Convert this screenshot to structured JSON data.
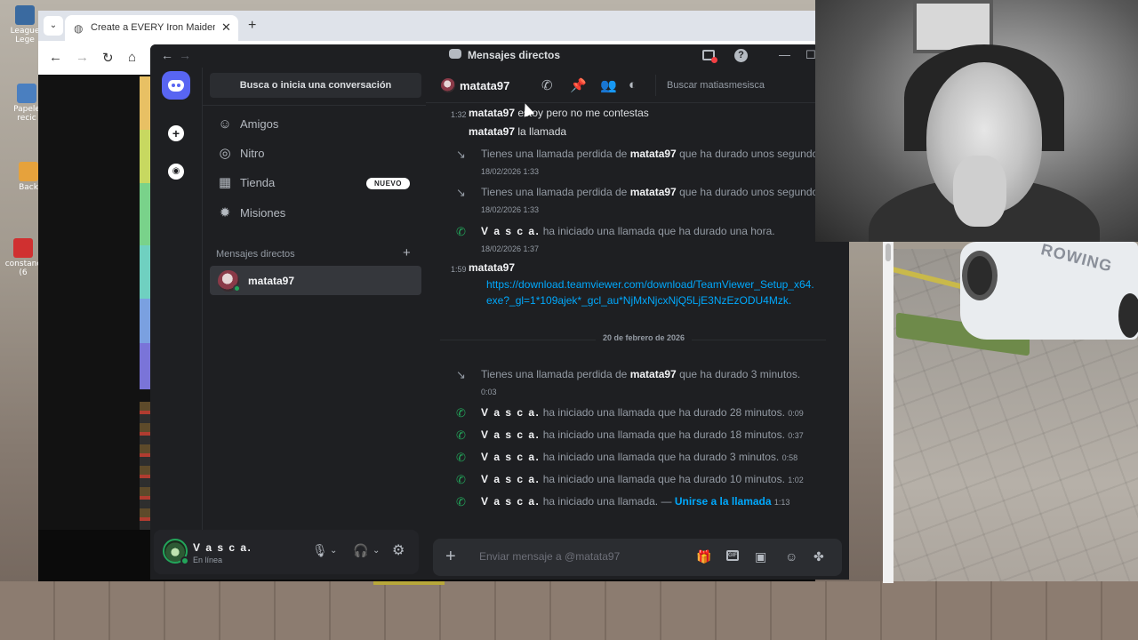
{
  "browser": {
    "tab_title": "Create a EVERY Iron Maiden Sc",
    "tab_close": "✕",
    "new_tab": "+"
  },
  "desktop": {
    "icons": [
      {
        "label": "League Lege",
        "color": "#3a6aa0"
      },
      {
        "label": "Papele recic",
        "color": "#4a7fc0"
      },
      {
        "label": "Back",
        "color": "#e6a23c"
      },
      {
        "label": "constanc (6",
        "color": "#d03030"
      }
    ]
  },
  "discord": {
    "window_title": "Mensajes directos",
    "search_placeholder": "Busca o inicia una conversación",
    "nav": [
      {
        "label": "Amigos",
        "icon": "friends-icon"
      },
      {
        "label": "Nitro",
        "icon": "nitro-icon"
      },
      {
        "label": "Tienda",
        "icon": "shop-icon",
        "badge": "NUEVO"
      },
      {
        "label": "Misiones",
        "icon": "quests-icon"
      }
    ],
    "dm_header": "Mensajes directos",
    "dm_header_add": "+",
    "dm_list": [
      {
        "name": "matata97",
        "status": "online"
      }
    ],
    "user": {
      "name": "V a s c a.",
      "status": "En línea"
    },
    "chat": {
      "recipient": "matata97",
      "search_placeholder": "Buscar matiasmesisca",
      "composer_placeholder": "Enviar mensaje a @matata97",
      "date_divider": "20 de febrero de 2026",
      "messages": [
        {
          "time": "1:32",
          "author": "matata97",
          "text": "estoy pero no me contestas"
        },
        {
          "author": "matata97",
          "text": "la llamada"
        },
        {
          "type": "missed",
          "pre": "Tienes una llamada perdida de",
          "who": "matata97",
          "post": "que ha durado unos segundos.",
          "stamp": "18/02/2026 1:33"
        },
        {
          "type": "missed",
          "pre": "Tienes una llamada perdida de",
          "who": "matata97",
          "post": "que ha durado unos segundos.",
          "stamp": "18/02/2026 1:33"
        },
        {
          "type": "call",
          "who": "V a s c a.",
          "post": "ha iniciado una llamada que ha durado una hora.",
          "stamp": "18/02/2026 1:37"
        },
        {
          "time": "1:59",
          "author": "matata97",
          "link": "https://download.teamviewer.com/download/TeamViewer_Setup_x64.exe?_gl=1*109ajek*_gcl_au*NjMxNjcxNjQ5LjE3NzEzODU4Mzk."
        },
        {
          "type": "missed",
          "pre": "Tienes una llamada perdida de",
          "who": "matata97",
          "post": "que ha durado 3 minutos.",
          "stamp": "0:03"
        },
        {
          "type": "call",
          "who": "V a s c a.",
          "post": "ha iniciado una llamada que ha durado 28 minutos.",
          "stamp": "0:09"
        },
        {
          "type": "call",
          "who": "V a s c a.",
          "post": "ha iniciado una llamada que ha durado 18 minutos.",
          "stamp": "0:37"
        },
        {
          "type": "call",
          "who": "V a s c a.",
          "post": "ha iniciado una llamada que ha durado 3 minutos.",
          "stamp": "0:58"
        },
        {
          "type": "call",
          "who": "V a s c a.",
          "post": "ha iniciado una llamada que ha durado 10 minutos.",
          "stamp": "1:02"
        },
        {
          "type": "call",
          "who": "V a s c a.",
          "post": "ha iniciado una llamada. —",
          "join": "Unirse a la llamada",
          "stamp": "1:13"
        }
      ]
    }
  },
  "webcam": {
    "badge_text": "ROWING"
  }
}
